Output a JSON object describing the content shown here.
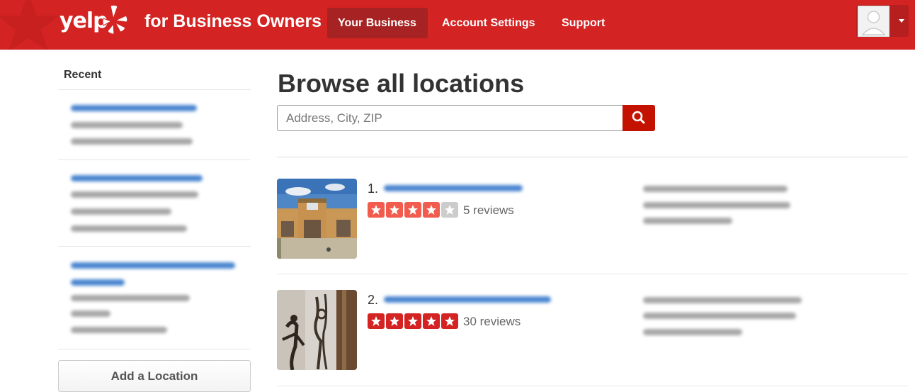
{
  "header": {
    "logo_text": "yelp",
    "tagline": "for Business Owners",
    "nav": [
      "Your Business",
      "Account Settings",
      "Support"
    ],
    "brand_color": "#d32323"
  },
  "sidebar": {
    "title": "Recent",
    "add_location_label": "Add a Location"
  },
  "main": {
    "title": "Browse all locations",
    "search_placeholder": "Address, City, ZIP",
    "locations": [
      {
        "rank": "1.",
        "rating": 4,
        "reviews": "5 reviews"
      },
      {
        "rank": "2.",
        "rating": 5,
        "reviews": "30 reviews"
      }
    ]
  },
  "colors": {
    "star_active": "#f15c4f",
    "star_full5": "#d32323",
    "star_empty": "#cccccc",
    "search_button": "#c41200"
  }
}
